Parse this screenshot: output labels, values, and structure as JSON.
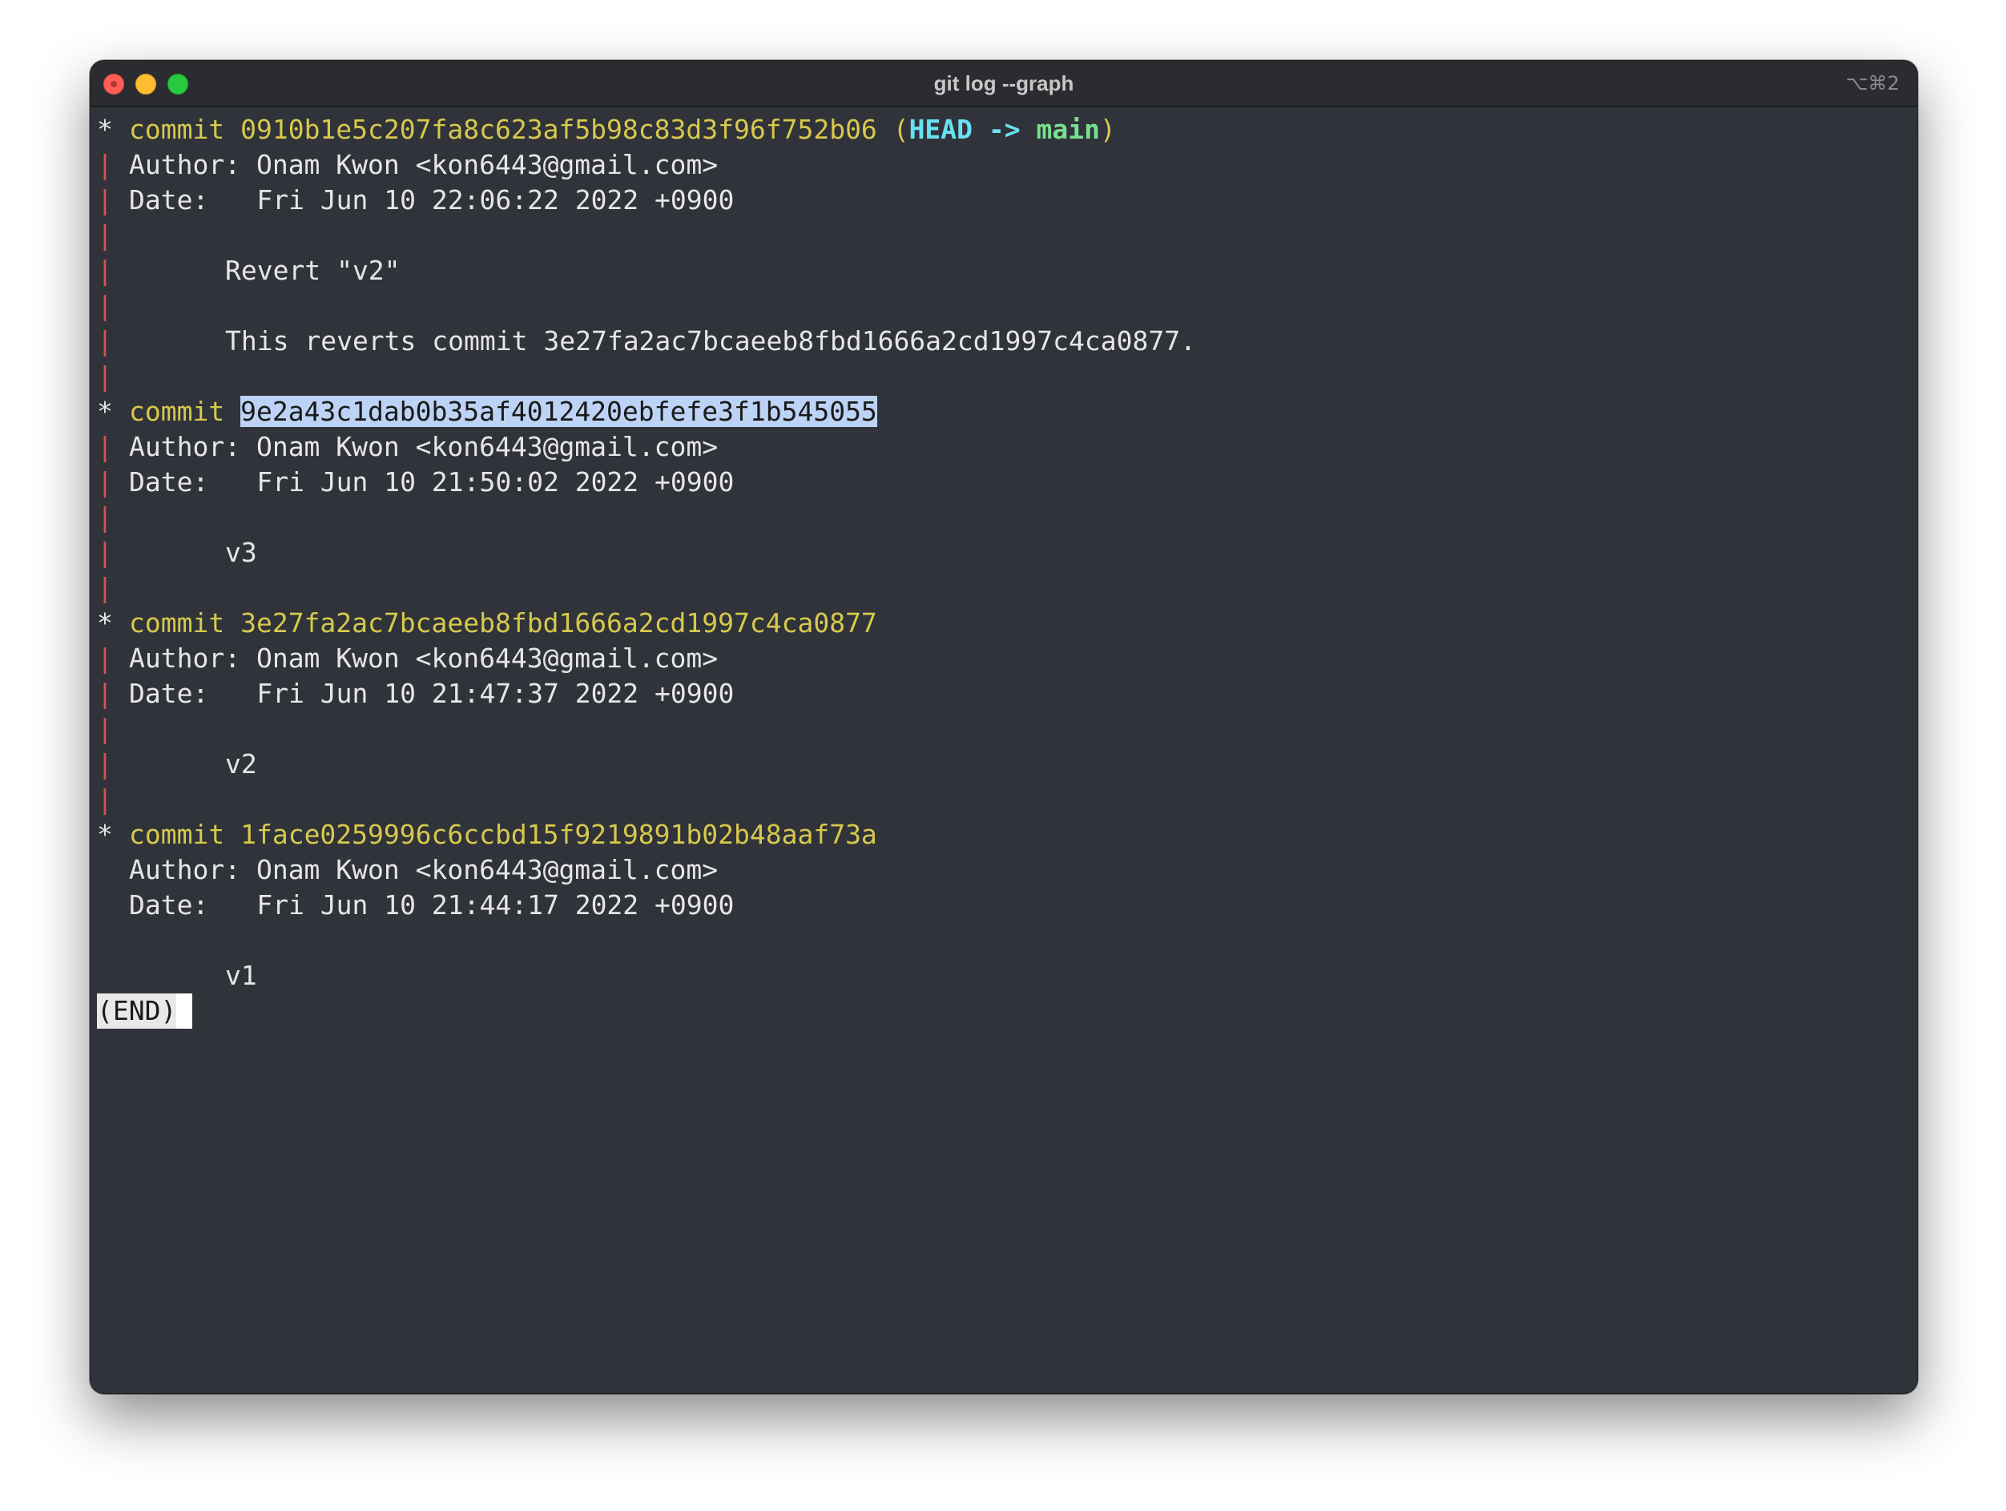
{
  "window": {
    "title": "git log --graph",
    "shortcut": "⌥⌘2"
  },
  "log": {
    "commits": [
      {
        "label": "commit",
        "hash": "0910b1e5c207fa8c623af5b98c83d3f96f752b06",
        "ref_open": "(",
        "ref_head": "HEAD",
        "ref_arrow": " -> ",
        "ref_branch": "main",
        "ref_close": ")",
        "author_label": "Author:",
        "author": "Onam Kwon <kon6443@gmail.com>",
        "date_label": "Date:",
        "date": "Fri Jun 10 22:06:22 2022 +0900",
        "message": "Revert \"v2\"",
        "body": "This reverts commit 3e27fa2ac7bcaeeb8fbd1666a2cd1997c4ca0877."
      },
      {
        "label": "commit",
        "hash": "9e2a43c1dab0b35af4012420ebfefe3f1b545055",
        "author_label": "Author:",
        "author": "Onam Kwon <kon6443@gmail.com>",
        "date_label": "Date:",
        "date": "Fri Jun 10 21:50:02 2022 +0900",
        "message": "v3"
      },
      {
        "label": "commit",
        "hash": "3e27fa2ac7bcaeeb8fbd1666a2cd1997c4ca0877",
        "author_label": "Author:",
        "author": "Onam Kwon <kon6443@gmail.com>",
        "date_label": "Date:",
        "date": "Fri Jun 10 21:47:37 2022 +0900",
        "message": "v2"
      },
      {
        "label": "commit",
        "hash": "1face0259996c6ccbd15f9219891b02b48aaf73a",
        "author_label": "Author:",
        "author": "Onam Kwon <kon6443@gmail.com>",
        "date_label": "Date:",
        "date": "Fri Jun 10 21:44:17 2022 +0900",
        "message": "v1"
      }
    ],
    "graph_node": "*",
    "graph_edge": "|",
    "pager_end": "(END)"
  },
  "colors": {
    "background": "#30333a",
    "commit_text": "#d7c94b",
    "graph_edge": "#d9534f",
    "head_ref": "#6ae0f2",
    "branch_ref": "#78e08f",
    "selection": "#bcd3f5"
  }
}
